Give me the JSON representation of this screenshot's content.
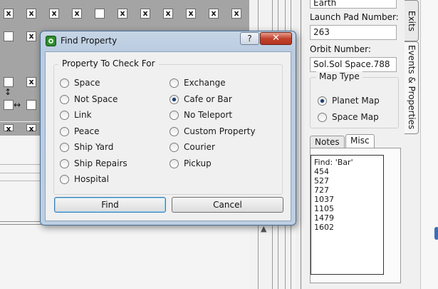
{
  "map": {
    "cells": [
      "x",
      "x",
      "x",
      "x",
      "",
      "x",
      "x",
      "x",
      "x",
      "x",
      "x",
      "x"
    ],
    "arrow_h": "↔",
    "arrow_v": "↕"
  },
  "right_panel": {
    "name_value": "Earth",
    "launch_pad_label": "Launch Pad Number:",
    "launch_pad_value": "263",
    "orbit_label": "Orbit Number:",
    "orbit_value": "Sol.Sol Space.788",
    "map_type": {
      "legend": "Map Type",
      "options": [
        {
          "label": "Planet Map",
          "checked": true
        },
        {
          "label": "Space Map",
          "checked": false
        }
      ]
    },
    "tabs": [
      {
        "label": "Notes",
        "active": false
      },
      {
        "label": "Misc",
        "active": true
      }
    ],
    "misc_lines": [
      "Find: 'Bar'",
      "454",
      "527",
      "727",
      "1037",
      "1105",
      "1479",
      "1602"
    ]
  },
  "side_tabs": [
    "Exits",
    "Events & Properties"
  ],
  "dialog": {
    "title": "Find Property",
    "help_label": "?",
    "close_label": "✕",
    "group_legend": "Property To Check For",
    "left_options": [
      {
        "label": "Space",
        "checked": false
      },
      {
        "label": "Not Space",
        "checked": false
      },
      {
        "label": "Link",
        "checked": false
      },
      {
        "label": "Peace",
        "checked": false
      },
      {
        "label": "Ship Yard",
        "checked": false
      },
      {
        "label": "Ship Repairs",
        "checked": false
      },
      {
        "label": "Hospital",
        "checked": false
      }
    ],
    "right_options": [
      {
        "label": "Exchange",
        "checked": false
      },
      {
        "label": "Cafe or Bar",
        "checked": true
      },
      {
        "label": "No Teleport",
        "checked": false
      },
      {
        "label": "Custom Property",
        "checked": false
      },
      {
        "label": "Courier",
        "checked": false
      },
      {
        "label": "Pickup",
        "checked": false
      }
    ],
    "find_label": "Find",
    "cancel_label": "Cancel"
  },
  "colors": {
    "dialog_frame": "#bccfe3",
    "close_button": "#c2422d",
    "radio_dot": "#1b3e70"
  }
}
